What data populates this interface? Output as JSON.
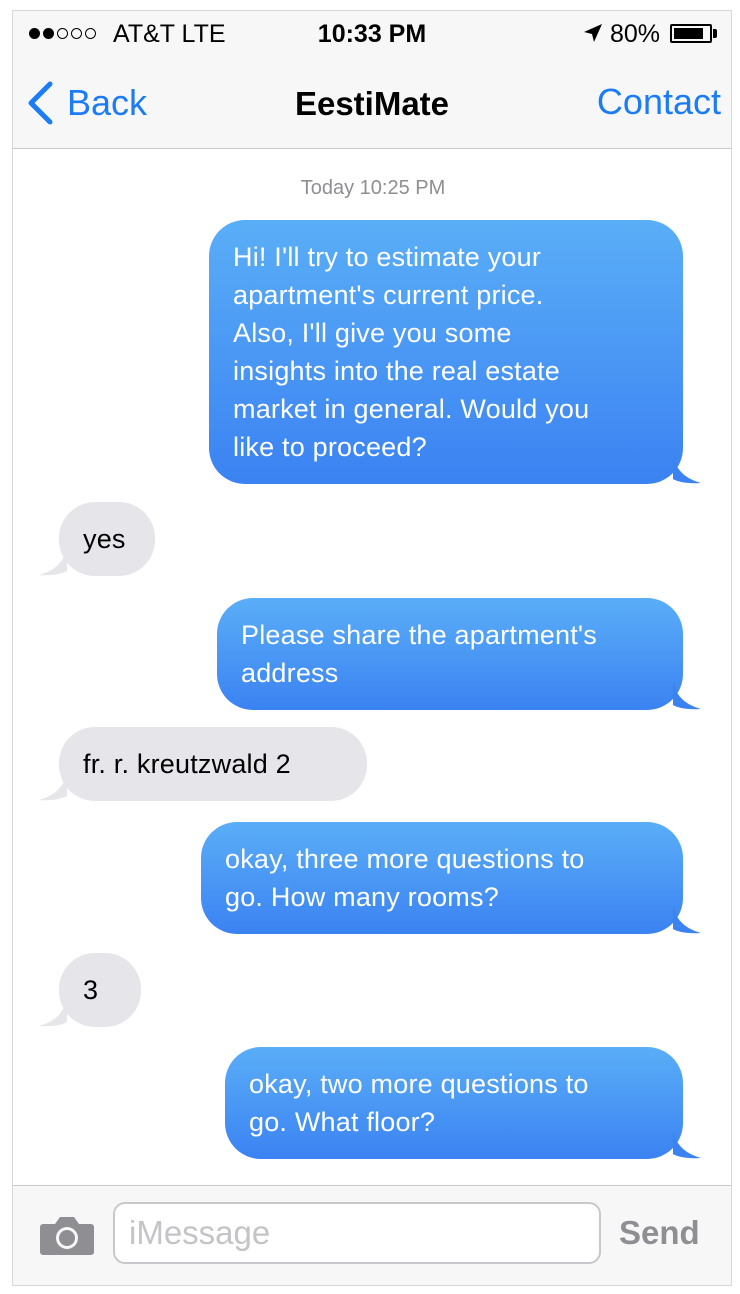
{
  "status_bar": {
    "signal_bars_filled": 2,
    "signal_bars_total": 5,
    "carrier": "AT&T LTE",
    "time": "10:33 PM",
    "battery_percent": "80%",
    "battery_level": 0.8,
    "location_icon": "location-arrow-icon",
    "battery_icon": "battery-icon"
  },
  "nav": {
    "back_label": "Back",
    "title": "EestiMate",
    "contact_label": "Contact",
    "accent_color": "#1c7cf5"
  },
  "thread": {
    "timestamp": "Today 10:25 PM",
    "messages": [
      {
        "direction": "outgoing",
        "lines": [
          "Hi! I'll try to estimate your",
          "apartment's current price.",
          "Also, I'll give you some",
          "insights into the real estate",
          "market in general. Would you",
          "like to proceed?"
        ]
      },
      {
        "direction": "incoming",
        "lines": [
          "yes"
        ]
      },
      {
        "direction": "outgoing",
        "lines": [
          "Please share the apartment's",
          "address"
        ]
      },
      {
        "direction": "incoming",
        "lines": [
          "fr. r. kreutzwald 2"
        ]
      },
      {
        "direction": "outgoing",
        "lines": [
          "okay, three more questions to",
          "go. How many rooms?"
        ]
      },
      {
        "direction": "incoming",
        "lines": [
          "3"
        ]
      },
      {
        "direction": "outgoing",
        "lines": [
          "okay, two more questions to",
          "go. What floor?"
        ]
      }
    ]
  },
  "composer": {
    "placeholder": "iMessage",
    "value": "",
    "send_label": "Send",
    "camera_icon": "camera-icon"
  },
  "colors": {
    "outgoing_gradient_top": "#5aaef7",
    "outgoing_gradient_bottom": "#3b82f2",
    "incoming_bubble": "#e5e5ea",
    "send_disabled": "#8e8e93"
  }
}
